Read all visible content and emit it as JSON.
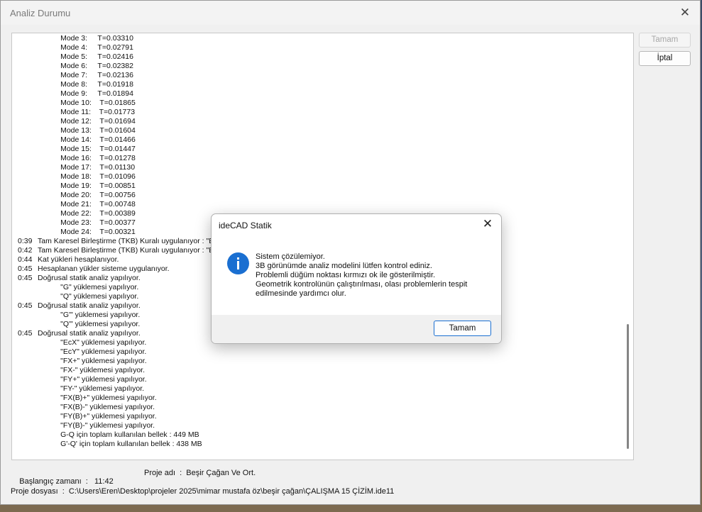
{
  "window": {
    "title": "Analiz Durumu",
    "close_glyph": "✕",
    "ok_button": "Tamam",
    "cancel_button": "İptal"
  },
  "log": [
    {
      "time": "",
      "text": "           Mode 3:     T=0.03310"
    },
    {
      "time": "",
      "text": "           Mode 4:     T=0.02791"
    },
    {
      "time": "",
      "text": "           Mode 5:     T=0.02416"
    },
    {
      "time": "",
      "text": "           Mode 6:     T=0.02382"
    },
    {
      "time": "",
      "text": "           Mode 7:     T=0.02136"
    },
    {
      "time": "",
      "text": "           Mode 8:     T=0.01918"
    },
    {
      "time": "",
      "text": "           Mode 9:     T=0.01894"
    },
    {
      "time": "",
      "text": "           Mode 10:    T=0.01865"
    },
    {
      "time": "",
      "text": "           Mode 11:    T=0.01773"
    },
    {
      "time": "",
      "text": "           Mode 12:    T=0.01694"
    },
    {
      "time": "",
      "text": "           Mode 13:    T=0.01604"
    },
    {
      "time": "",
      "text": "           Mode 14:    T=0.01466"
    },
    {
      "time": "",
      "text": "           Mode 15:    T=0.01447"
    },
    {
      "time": "",
      "text": "           Mode 16:    T=0.01278"
    },
    {
      "time": "",
      "text": "           Mode 17:    T=0.01130"
    },
    {
      "time": "",
      "text": "           Mode 18:    T=0.01096"
    },
    {
      "time": "",
      "text": "           Mode 19:    T=0.00851"
    },
    {
      "time": "",
      "text": "           Mode 20:    T=0.00756"
    },
    {
      "time": "",
      "text": "           Mode 21:    T=0.00748"
    },
    {
      "time": "",
      "text": "           Mode 22:    T=0.00389"
    },
    {
      "time": "",
      "text": "           Mode 23:    T=0.00377"
    },
    {
      "time": "",
      "text": "           Mode 24:    T=0.00321"
    },
    {
      "time": "0:39",
      "text": "Tam Karesel Birleştirme (TKB) Kuralı uygulanıyor : \"E"
    },
    {
      "time": "0:42",
      "text": "Tam Karesel Birleştirme (TKB) Kuralı uygulanıyor : \"E"
    },
    {
      "time": "0:44",
      "text": "Kat yükleri hesaplanıyor."
    },
    {
      "time": "0:45",
      "text": "Hesaplanan yükler sisteme uygulanıyor."
    },
    {
      "time": "0:45",
      "text": "Doğrusal statik analiz yapılıyor."
    },
    {
      "time": "",
      "text": "           \"G\" yüklemesi yapılıyor."
    },
    {
      "time": "",
      "text": "           \"Q\" yüklemesi yapılıyor."
    },
    {
      "time": "0:45",
      "text": "Doğrusal statik analiz yapılıyor."
    },
    {
      "time": "",
      "text": "           \"G'\" yüklemesi yapılıyor."
    },
    {
      "time": "",
      "text": "           \"Q'\" yüklemesi yapılıyor."
    },
    {
      "time": "0:45",
      "text": "Doğrusal statik analiz yapılıyor."
    },
    {
      "time": "",
      "text": "           \"EcX\" yüklemesi yapılıyor."
    },
    {
      "time": "",
      "text": "           \"EcY\" yüklemesi yapılıyor."
    },
    {
      "time": "",
      "text": "           \"FX+\" yüklemesi yapılıyor."
    },
    {
      "time": "",
      "text": "           \"FX-\" yüklemesi yapılıyor."
    },
    {
      "time": "",
      "text": "           \"FY+\" yüklemesi yapılıyor."
    },
    {
      "time": "",
      "text": "           \"FY-\" yüklemesi yapılıyor."
    },
    {
      "time": "",
      "text": "           \"FX(B)+\" yüklemesi yapılıyor."
    },
    {
      "time": "",
      "text": "           \"FX(B)-\" yüklemesi yapılıyor."
    },
    {
      "time": "",
      "text": "           \"FY(B)+\" yüklemesi yapılıyor."
    },
    {
      "time": "",
      "text": "           \"FY(B)-\" yüklemesi yapılıyor."
    },
    {
      "time": "",
      "text": "           G-Q için toplam kullanılan bellek : 449 MB"
    },
    {
      "time": "",
      "text": "           G'-Q' için toplam kullanılan bellek : 438 MB"
    }
  ],
  "footer": {
    "start_time": "Başlangıç zamanı  :   11:42",
    "project_name": "Proje adı  :  Beşir Çağan Ve Ort.",
    "project_file": "Proje dosyası  :  C:\\Users\\Eren\\Desktop\\projeler 2025\\mimar mustafa öz\\beşir çağan\\ÇALIŞMA 15 ÇİZİM.ide11"
  },
  "dialog": {
    "title": "ideCAD Statik",
    "close_glyph": "✕",
    "icon": "info-icon",
    "icon_color": "#1a6fd1",
    "message": [
      "Sistem çözülemiyor.",
      "3B görünümde analiz modelini lütfen kontrol ediniz.",
      "Problemli düğüm noktası kırmızı ok ile gösterilmiştir.",
      "Geometrik kontrolünün çalıştırılması, olası problemlerin tespit",
      "edilmesinde yardımcı olur."
    ],
    "ok_button": "Tamam"
  }
}
